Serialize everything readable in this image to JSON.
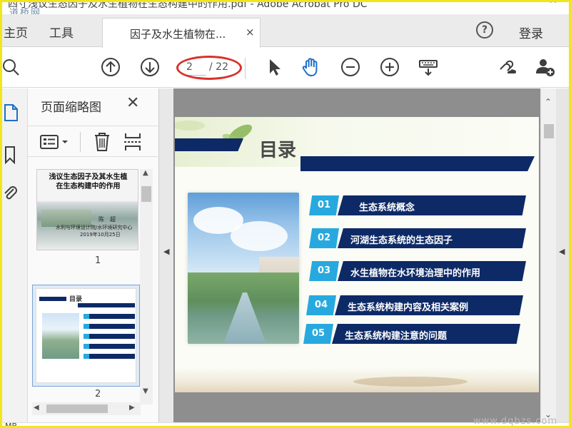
{
  "window": {
    "title": "四寸浅议生态因子及水生植物在生态构建中的作用.pdf - Adobe Acrobat Pro DC",
    "watermark_top": "道桥网"
  },
  "tabs": {
    "home": "主页",
    "tools": "工具",
    "document": "因子及水生植物在...",
    "document_close": "×"
  },
  "header": {
    "help": "?",
    "login": "登录"
  },
  "toolbar": {
    "page_current": "2",
    "page_total": "/ 22",
    "highlight_color": "#d9312a"
  },
  "thumbnail_panel": {
    "title": "页面缩略图",
    "close": "✕",
    "thumbnails": [
      {
        "number": "1",
        "title_line1": "浅议生态因子及其水生植",
        "title_line2": "在生态构建中的作用",
        "author": "陈　超",
        "org": "水利与环境设计院/水环境研究中心",
        "date": "2019年10月25日"
      },
      {
        "number": "2",
        "title": "目录"
      }
    ]
  },
  "slide": {
    "title": "目录",
    "items": [
      {
        "num": "01",
        "text": "生态系统概念"
      },
      {
        "num": "02",
        "text": "河湖生态系统的生态因子"
      },
      {
        "num": "03",
        "text": "水生植物在水环境治理中的作用"
      },
      {
        "num": "04",
        "text": "生态系统构建内容及相关案例"
      },
      {
        "num": "05",
        "text": "生态系统构建注意的问题"
      }
    ],
    "colors": {
      "number_blue": "#27a9df",
      "bar_navy": "#0d2a66"
    }
  },
  "status": {
    "size_label": "MB",
    "watermark_bottom": "www.dqbzs.com"
  }
}
